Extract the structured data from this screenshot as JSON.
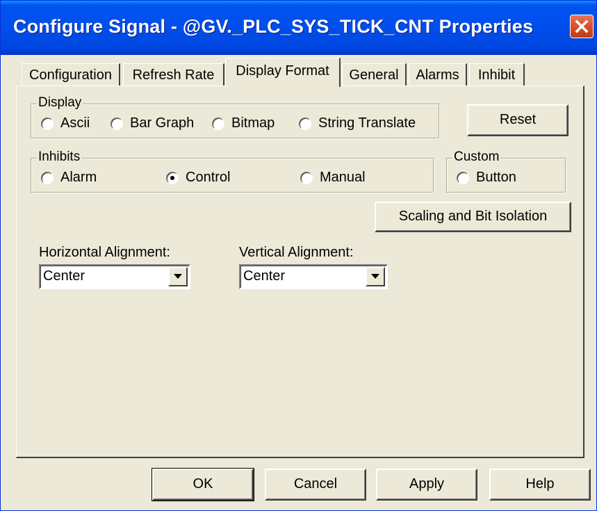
{
  "window": {
    "title": "Configure Signal - @GV._PLC_SYS_TICK_CNT Properties",
    "close_icon": "close-x-icon"
  },
  "tabs": [
    {
      "label": "Configuration",
      "active": false
    },
    {
      "label": "Refresh Rate",
      "active": false
    },
    {
      "label": "Display Format",
      "active": true
    },
    {
      "label": "General",
      "active": false
    },
    {
      "label": "Alarms",
      "active": false
    },
    {
      "label": "Inhibit",
      "active": false
    }
  ],
  "display_group": {
    "label": "Display",
    "options": [
      {
        "label": "Ascii",
        "checked": false
      },
      {
        "label": "Bar Graph",
        "checked": false
      },
      {
        "label": "Bitmap",
        "checked": false
      },
      {
        "label": "String Translate",
        "checked": false
      }
    ]
  },
  "reset_button": "Reset",
  "inhibits_group": {
    "label": "Inhibits",
    "options": [
      {
        "label": "Alarm",
        "checked": false
      },
      {
        "label": "Control",
        "checked": true
      },
      {
        "label": "Manual",
        "checked": false
      }
    ]
  },
  "custom_group": {
    "label": "Custom",
    "options": [
      {
        "label": "Button",
        "checked": false
      }
    ]
  },
  "scaling_button": "Scaling and Bit Isolation",
  "horizontal_alignment": {
    "label": "Horizontal Alignment:",
    "value": "Center"
  },
  "vertical_alignment": {
    "label": "Vertical Alignment:",
    "value": "Center"
  },
  "footer": {
    "ok": "OK",
    "cancel": "Cancel",
    "apply": "Apply",
    "help": "Help"
  },
  "colors": {
    "titlebar": "#0050ee",
    "dialog_bg": "#ece9d8",
    "close_button": "#d8502c"
  }
}
